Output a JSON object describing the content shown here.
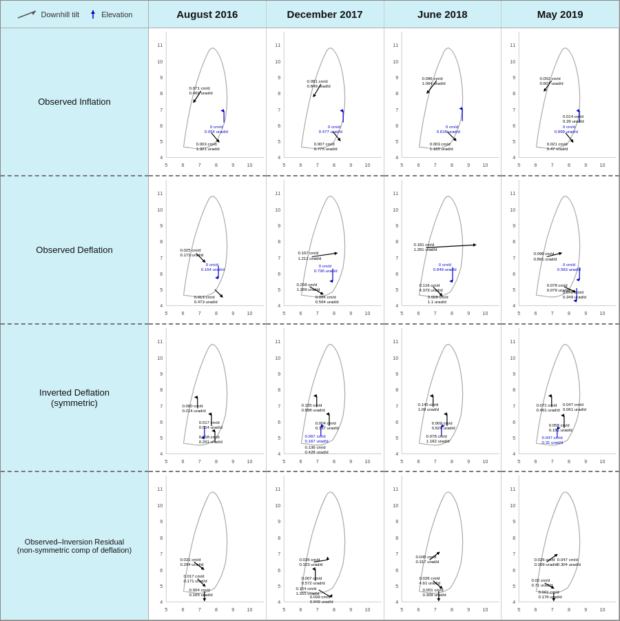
{
  "legend": {
    "downhill_label": "Downhill tilt",
    "elevation_label": "Elevation"
  },
  "columns": [
    "August 2016",
    "December 2017",
    "June 2018",
    "May 2019"
  ],
  "rows": [
    "Observed Inflation",
    "Observed Deflation",
    "Inverted Deflation\n(symmetric)",
    "Observed–Inversion Residual\n(non-symmetric comp of deflation)"
  ]
}
